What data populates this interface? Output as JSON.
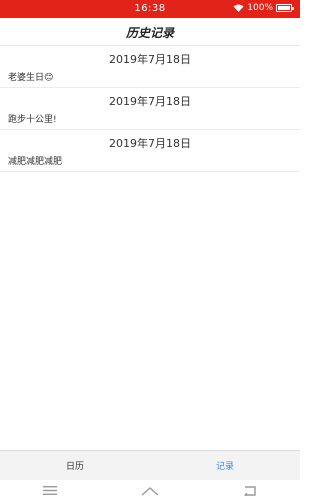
{
  "status_bar": {
    "time": "16:38",
    "battery": "100%",
    "icons": [
      "wifi-icon",
      "battery-icon"
    ],
    "color": "#e2231a"
  },
  "header": {
    "title": "历史记录"
  },
  "records": [
    {
      "date": "2019年7月18日",
      "text": "老婆生日😊"
    },
    {
      "date": "2019年7月18日",
      "text": "跑步十公里!"
    },
    {
      "date": "2019年7月18日",
      "text": "减肥减肥减肥"
    }
  ],
  "tabs": [
    {
      "label": "日历",
      "active": false
    },
    {
      "label": "记录",
      "active": true
    }
  ],
  "nav_bar": {
    "icons": [
      "menu-icon",
      "home-icon",
      "back-icon"
    ]
  },
  "colors": {
    "accent": "#3a8be8",
    "status_bar": "#e2231a"
  }
}
